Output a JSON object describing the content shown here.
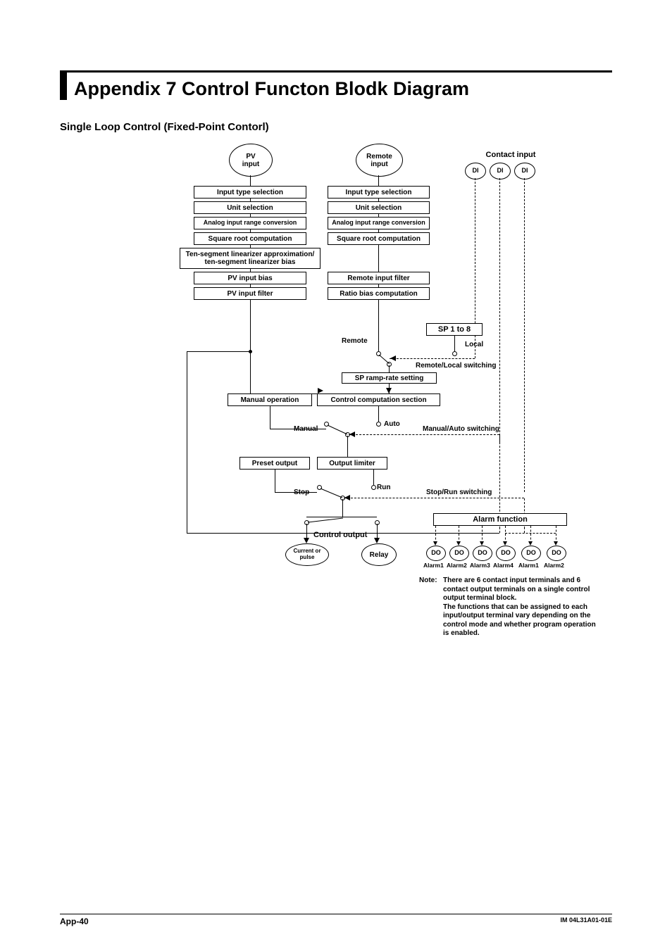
{
  "header": {
    "title": "Appendix 7  Control Functon Blodk Diagram",
    "subtitle": "Single Loop Control (Fixed-Point Contorl)"
  },
  "top_inputs": {
    "pv": "PV\ninput",
    "remote": "Remote\ninput",
    "contact": "Contact input",
    "di": "DI"
  },
  "pv_chain": [
    "Input type selection",
    "Unit selection",
    "Analog input range conversion",
    "Square root computation",
    "Ten-segment linearizer approximation/\nten-segment linearizer bias",
    "PV input bias",
    "PV input filter"
  ],
  "remote_chain": [
    "Input type selection",
    "Unit selection",
    "Analog input range conversion",
    "Square root computation",
    "Remote input filter",
    "Ratio bias computation"
  ],
  "sp": {
    "block": "SP 1 to 8",
    "remote": "Remote",
    "local": "Local",
    "switch": "Remote/Local switching",
    "ramp": "SP ramp-rate setting"
  },
  "control": {
    "manual_op": "Manual operation",
    "comp": "Control computation section",
    "manual": "Manual",
    "auto": "Auto",
    "ma_switch": "Manual/Auto switching"
  },
  "output": {
    "preset": "Preset output",
    "limiter": "Output limiter",
    "stop": "Stop",
    "run": "Run",
    "sr_switch": "Stop/Run switching",
    "control_output": "Control output",
    "current": "Current or\npulse",
    "relay": "Relay"
  },
  "alarm": {
    "function": "Alarm function",
    "do": "DO",
    "labels": [
      "Alarm1",
      "Alarm2",
      "Alarm3",
      "Alarm4",
      "Alarm1",
      "Alarm2"
    ]
  },
  "note": {
    "prefix": "Note:",
    "body": "There are 6 contact input terminals and 6 contact output terminals on a single control output terminal block.\nThe functions that can be assigned to each input/output terminal vary depending on the control mode and whether program operation is enabled."
  },
  "footer": {
    "left": "App-40",
    "right": "IM 04L31A01-01E"
  }
}
